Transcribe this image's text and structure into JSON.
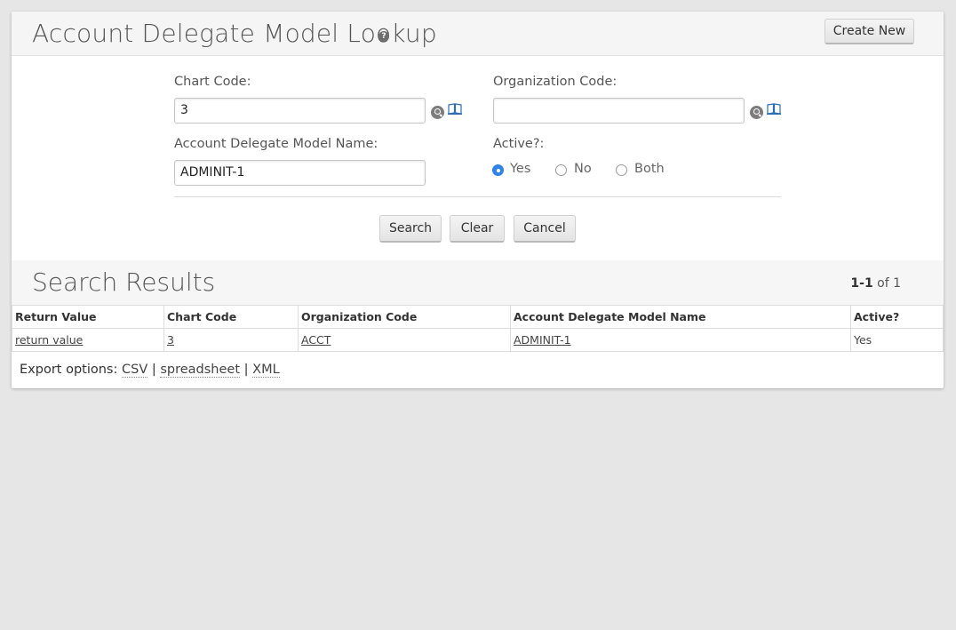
{
  "header": {
    "title": "Account Delegate Model Lookup",
    "help_icon": "question-circle-icon",
    "create_new_label": "Create New"
  },
  "form": {
    "chart_code": {
      "label": "Chart Code:",
      "value": "3"
    },
    "organization_code": {
      "label": "Organization Code:",
      "value": ""
    },
    "model_name": {
      "label": "Account Delegate Model Name:",
      "value": "ADMINIT-1"
    },
    "active": {
      "label": "Active?:",
      "options": [
        "Yes",
        "No",
        "Both"
      ],
      "selected": "Yes"
    },
    "buttons": {
      "search": "Search",
      "clear": "Clear",
      "cancel": "Cancel"
    }
  },
  "results": {
    "title": "Search Results",
    "count_range": "1-1",
    "count_of": "of 1",
    "columns": [
      "Return Value",
      "Chart Code",
      "Organization Code",
      "Account Delegate Model Name",
      "Active?"
    ],
    "rows": [
      [
        "return value",
        "3",
        "ACCT",
        "ADMINIT-1",
        "Yes"
      ]
    ],
    "export": {
      "label": "Export options:",
      "csv": "CSV",
      "spreadsheet": "spreadsheet",
      "xml": "XML",
      "separator": "|"
    }
  },
  "colors": {
    "background": "#e6e6e6",
    "panel": "#ffffff",
    "radio_accent": "#2f82e8"
  }
}
